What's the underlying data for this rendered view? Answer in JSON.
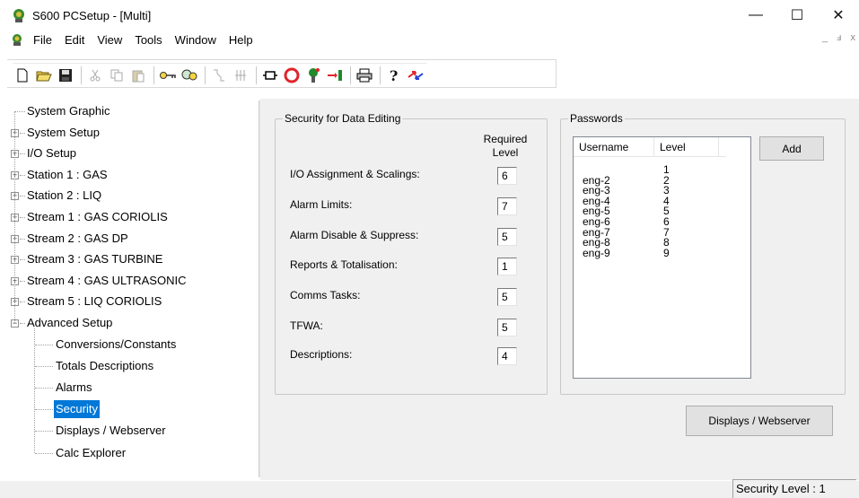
{
  "window": {
    "title": "S600 PCSetup  - [Multi]",
    "minimize": "—",
    "maximize": "☐",
    "close": "✕"
  },
  "menu": {
    "items": [
      "File",
      "Edit",
      "View",
      "Tools",
      "Window",
      "Help"
    ],
    "mdi_min": "_",
    "mdi_restore": "ⅎ",
    "mdi_close": "x"
  },
  "tree": {
    "items": [
      {
        "label": "System Graphic",
        "expandable": false
      },
      {
        "label": "System Setup",
        "expandable": true
      },
      {
        "label": "I/O Setup",
        "expandable": true
      },
      {
        "label": "Station 1 : GAS",
        "expandable": true
      },
      {
        "label": "Station 2 : LIQ",
        "expandable": true
      },
      {
        "label": "Stream 1 : GAS CORIOLIS",
        "expandable": true
      },
      {
        "label": "Stream 2 : GAS DP",
        "expandable": true
      },
      {
        "label": "Stream 3 : GAS TURBINE",
        "expandable": true
      },
      {
        "label": "Stream 4 : GAS ULTRASONIC",
        "expandable": true
      },
      {
        "label": "Stream 5 : LIQ CORIOLIS",
        "expandable": true
      },
      {
        "label": "Advanced Setup",
        "expandable": true,
        "expanded": true
      }
    ],
    "children": [
      "Conversions/Constants",
      "Totals Descriptions",
      "Alarms",
      "Security",
      "Displays / Webserver",
      "Calc Explorer"
    ],
    "selected": "Security"
  },
  "security": {
    "group_title": "Security for Data Editing",
    "required_header": "Required",
    "level_header": "Level",
    "fields": [
      {
        "label": "I/O Assignment & Scalings:",
        "value": "6"
      },
      {
        "label": "Alarm Limits:",
        "value": "7"
      },
      {
        "label": "Alarm Disable & Suppress:",
        "value": "5"
      },
      {
        "label": "Reports & Totalisation:",
        "value": "1"
      },
      {
        "label": "Comms Tasks:",
        "value": "5"
      },
      {
        "label": "TFWA:",
        "value": "5"
      },
      {
        "label": "Descriptions:",
        "value": "4"
      }
    ]
  },
  "passwords": {
    "group_title": "Passwords",
    "col_username": "Username",
    "col_level": "Level",
    "rows": [
      {
        "username": "",
        "level": "1"
      },
      {
        "username": "eng-2",
        "level": "2"
      },
      {
        "username": "eng-3",
        "level": "3"
      },
      {
        "username": "eng-4",
        "level": "4"
      },
      {
        "username": "eng-5",
        "level": "5"
      },
      {
        "username": "eng-6",
        "level": "6"
      },
      {
        "username": "eng-7",
        "level": "7"
      },
      {
        "username": "eng-8",
        "level": "8"
      },
      {
        "username": "eng-9",
        "level": "9"
      }
    ],
    "add_button": "Add"
  },
  "displays_button": "Displays / Webserver",
  "status": {
    "security_level": "Security Level : 1"
  },
  "colors": {
    "selection": "#0078d7",
    "panel": "#f0f0f0"
  },
  "toolbar_icons": [
    "new-icon",
    "open-icon",
    "save-icon",
    "cut-icon",
    "copy-icon",
    "paste-icon",
    "key-icon",
    "search-icon",
    "connect-icon",
    "io-icon",
    "port-icon",
    "stop-icon",
    "tree-icon",
    "transfer-icon",
    "print-icon",
    "help-icon",
    "compare-icon"
  ]
}
